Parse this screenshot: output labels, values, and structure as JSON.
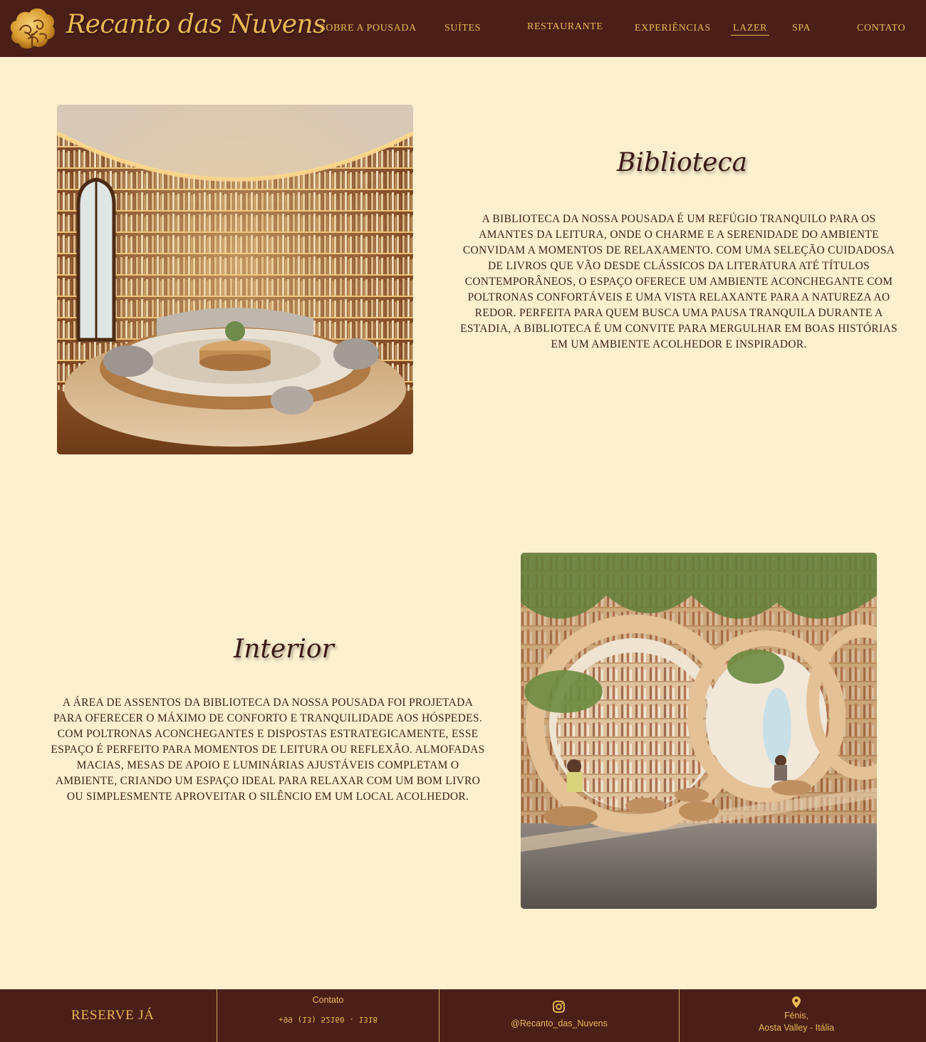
{
  "header": {
    "brand": "Recanto das Nuvens",
    "logo_icon": "golden-cloud-tree-logo",
    "nav": [
      {
        "label": "SOBRE A POUSADA"
      },
      {
        "label": "SUÍTES"
      },
      {
        "label": "RESTAURANTE"
      },
      {
        "label": "EXPERIÊNCIAS"
      },
      {
        "label": "LAZER",
        "active": true
      },
      {
        "label": "SPA"
      },
      {
        "label": "CONTATO"
      }
    ]
  },
  "sections": [
    {
      "title": "Biblioteca",
      "text": "A biblioteca da nossa pousada é um refúgio tranquilo para os amantes da leitura, onde o charme e a serenidade do ambiente convidam a momentos de relaxamento. Com uma seleção cuidadosa de livros que vão desde clássicos da literatura até títulos contemporâneos, o espaço oferece um ambiente aconchegante com poltronas confortáveis e uma vista relaxante para a natureza ao redor. Perfeita para quem busca uma pausa tranquila durante a estadia, a biblioteca é um convite para mergulhar em boas histórias em um ambiente acolhedor e inspirador."
    },
    {
      "title": "Interior",
      "text": "A área de assentos da biblioteca da nossa pousada foi projetada para oferecer o máximo de conforto e tranquilidade aos hóspedes. Com poltronas aconchegantes e dispostas estrategicamente, esse espaço é perfeito para momentos de  leitura ou reflexão. Almofadas macias, mesas de apoio e luminárias  ajustáveis completam o ambiente, criando um espaço ideal para relaxar com um bom livro ou simplesmente aproveitar o silêncio em um local acolhedor."
    }
  ],
  "footer": {
    "reserve_label": "RESERVE JÁ",
    "contact_title": "Contato",
    "contact_phone": "+99 (13) 52160 - 1318",
    "instagram_icon": "instagram-icon",
    "instagram_handle": "@Recanto_das_Nuvens",
    "location_icon": "map-pin-icon",
    "location_line1": "Fénis,",
    "location_line2": "Aosta Valley -  Itália"
  },
  "colors": {
    "header_bg": "#4a1f18",
    "page_bg": "#fdf0cf",
    "accent_gold": "#e9b954",
    "text_dark": "#3d2218"
  }
}
